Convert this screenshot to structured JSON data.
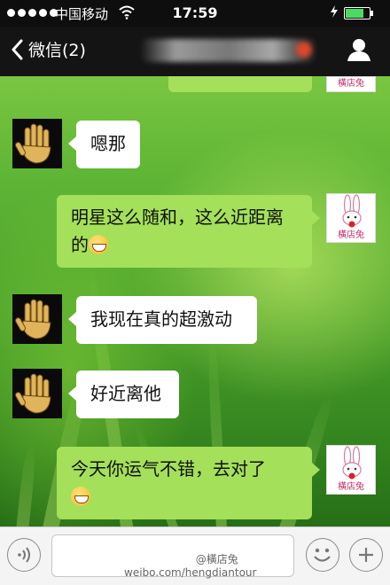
{
  "status_bar": {
    "carrier": "中国移动",
    "time": "17:59",
    "battery_level": 0.7
  },
  "nav": {
    "back_label": "微信(2)"
  },
  "avatars": {
    "rabbit_caption": "橫店兔"
  },
  "messages": [
    {
      "side": "left",
      "text": "嗯那"
    },
    {
      "side": "right",
      "text": "明星这么随和，这么近距离的",
      "emoji": "grin-face"
    },
    {
      "side": "left",
      "text": "我现在真的超激动"
    },
    {
      "side": "left",
      "text": "好近离他"
    },
    {
      "side": "right",
      "text": "今天你运气不错，去对了",
      "emoji": "grin-face"
    }
  ],
  "watermark": {
    "handle": "@橫店兔",
    "url": "weibo.com/hengdiantour"
  },
  "colors": {
    "sent_bubble": "#a4e05a",
    "received_bubble": "#ffffff",
    "nav_bg": "#141414"
  }
}
